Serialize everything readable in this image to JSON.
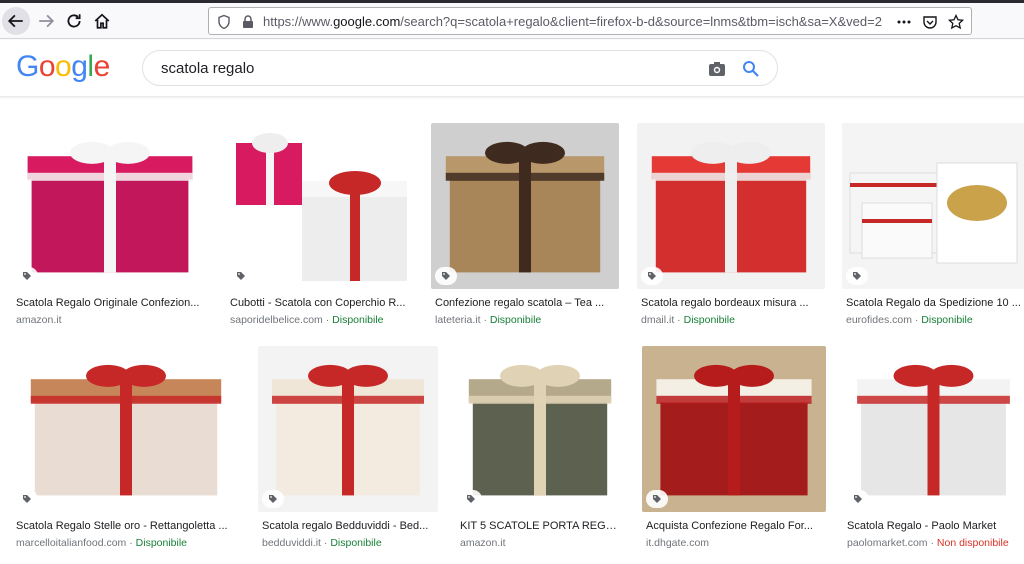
{
  "browser": {
    "url_prefix": "https://www.",
    "url_domain": "google.com",
    "url_rest": "/search?q=scatola+regalo&client=firefox-b-d&source=lnms&tbm=isch&sa=X&ved=2",
    "icons": [
      "back-icon",
      "forward-icon",
      "reload-icon",
      "home-icon",
      "shield-icon",
      "lock-icon",
      "more-icon",
      "pocket-icon",
      "star-icon"
    ]
  },
  "google": {
    "logo": [
      "G",
      "o",
      "o",
      "g",
      "l",
      "e"
    ],
    "logo_colors": [
      "#4285F4",
      "#EA4335",
      "#FBBC05",
      "#4285F4",
      "#34A853",
      "#EA4335"
    ],
    "query": "scatola regalo"
  },
  "results": [
    {
      "title": "Scatola Regalo Originale Confezion...",
      "source": "amazon.it",
      "status": ""
    },
    {
      "title": "Cubotti - Scatola con Coperchio R...",
      "source": "saporidelbelice.com",
      "status": "Disponibile"
    },
    {
      "title": "Confezione regalo scatola – Tea ...",
      "source": "lateteria.it",
      "status": "Disponibile"
    },
    {
      "title": "Scatola regalo bordeaux misura ...",
      "source": "dmail.it",
      "status": "Disponibile"
    },
    {
      "title": "Scatola Regalo da Spedizione 10 ...",
      "source": "eurofides.com",
      "status": "Disponibile"
    },
    {
      "title": "Scatola Regalo Stelle oro - Rettangoletta ...",
      "source": "marcelloitalianfood.com",
      "status": "Disponibile"
    },
    {
      "title": "Scatola regalo Bedduviddi - Bed...",
      "source": "bedduviddi.it",
      "status": "Disponibile"
    },
    {
      "title": "KIT 5 SCATOLE PORTA REGAL...",
      "source": "amazon.it",
      "status": ""
    },
    {
      "title": "Acquista Confezione Regalo For...",
      "source": "it.dhgate.com",
      "status": ""
    },
    {
      "title": "Scatola Regalo - Paolo Market",
      "source": "paolomarket.com",
      "status": "Non disponibile"
    }
  ],
  "colors": {
    "available": "#188038",
    "unavailable": "#d93025",
    "google_blue": "#4285F4"
  }
}
